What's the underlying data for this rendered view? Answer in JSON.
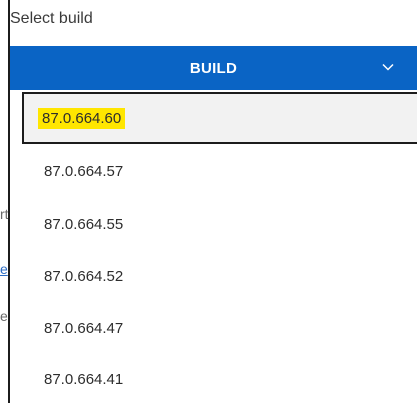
{
  "field": {
    "label": "Select build"
  },
  "dropdown": {
    "button_label": "BUILD",
    "chevron_icon": "chevron-down-icon"
  },
  "builds": [
    {
      "label": "87.0.664.60",
      "selected": true
    },
    {
      "label": "87.0.664.57"
    },
    {
      "label": "87.0.664.55"
    },
    {
      "label": "87.0.664.52"
    },
    {
      "label": "87.0.664.47"
    },
    {
      "label": "87.0.664.41"
    }
  ],
  "background_fragments": [
    "rt",
    "e",
    "el"
  ],
  "colors": {
    "accent": "#0a64c5",
    "highlight": "#ffe600"
  }
}
